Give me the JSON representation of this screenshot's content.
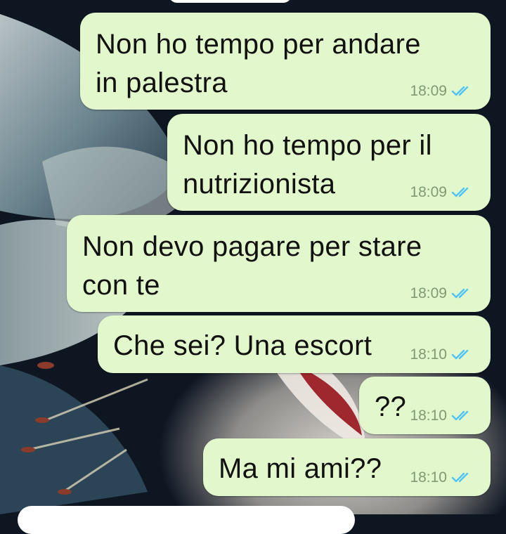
{
  "chat": {
    "messages": [
      {
        "text_lines": [
          "Non ho tempo per andare",
          "in palestra"
        ],
        "time": "18:09",
        "status": "read"
      },
      {
        "text_lines": [
          "Non ho tempo per il",
          "nutrizionista"
        ],
        "time": "18:09",
        "status": "read"
      },
      {
        "text_lines": [
          "Non devo pagare per stare",
          "con te"
        ],
        "time": "18:09",
        "status": "read"
      },
      {
        "text_lines": [
          "Che sei? Una escort"
        ],
        "time": "18:10",
        "status": "read"
      },
      {
        "text_lines": [
          "??"
        ],
        "time": "18:10",
        "status": "read"
      },
      {
        "text_lines": [
          "Ma mi ami??"
        ],
        "time": "18:10",
        "status": "read"
      }
    ]
  },
  "colors": {
    "outgoing_bubble": "#e2f7cb",
    "timestamp": "#7f9a72",
    "read_ticks": "#4fc3f7",
    "wallpaper_dark": "#0e1622"
  },
  "icons": {
    "read_status": "double-check-icon"
  }
}
